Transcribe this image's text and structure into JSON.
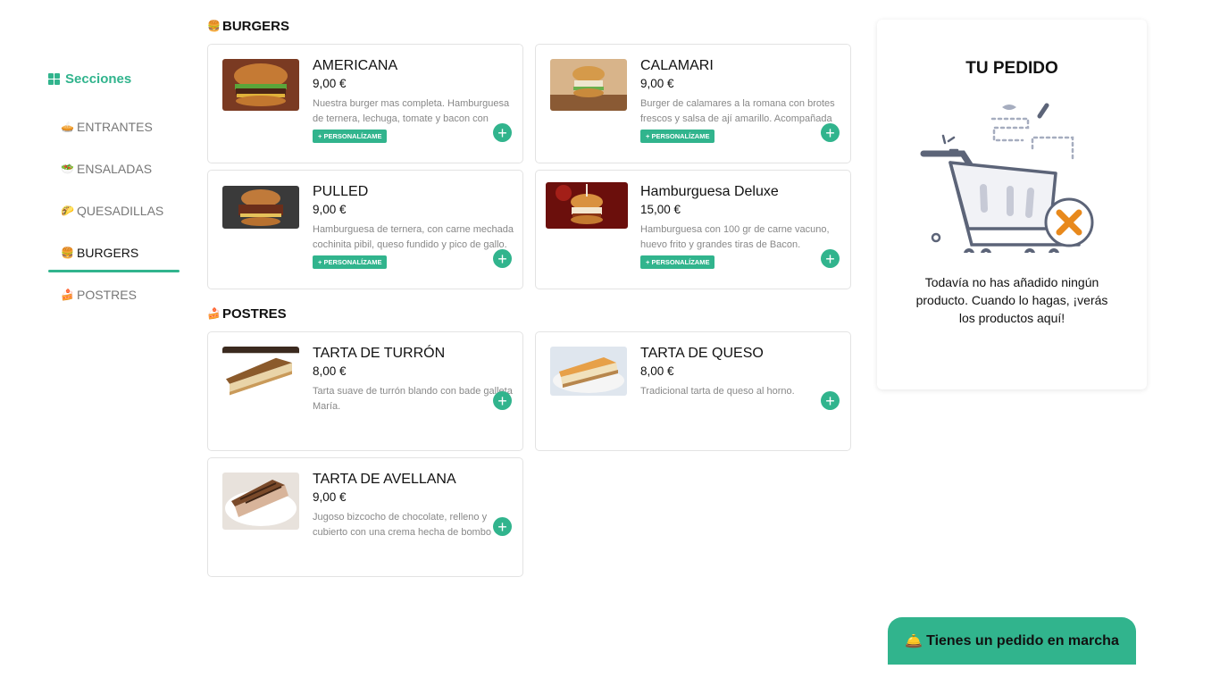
{
  "sidebar": {
    "title": "Secciones",
    "items": [
      {
        "emoji": "🥧",
        "label": "ENTRANTES",
        "active": false
      },
      {
        "emoji": "🥗",
        "label": "ENSALADAS",
        "active": false
      },
      {
        "emoji": "🌮",
        "label": "QUESADILLAS",
        "active": false
      },
      {
        "emoji": "🍔",
        "label": "BURGERS",
        "active": true
      },
      {
        "emoji": "🍰",
        "label": "POSTRES",
        "active": false
      }
    ]
  },
  "sections": {
    "burgers": {
      "emoji": "🍔",
      "title": "BURGERS",
      "products": [
        {
          "name": "AMERICANA",
          "price": "9,00 €",
          "description": "Nuestra burger mas completa. Hamburguesa de ternera, lechuga, tomate y bacon con",
          "badge": "+ PERSONALÍZAME",
          "add": "+"
        },
        {
          "name": "CALAMARI",
          "price": "9,00 €",
          "description": "Burger de calamares a la romana con brotes frescos y salsa de ají amarillo. Acompañada",
          "badge": "+ PERSONALÍZAME",
          "add": "+"
        },
        {
          "name": "PULLED",
          "price": "9,00 €",
          "description": "Hamburguesa de ternera, con carne mechada cochinita pibil, queso fundido y pico de gallo.",
          "badge": "+ PERSONALÍZAME",
          "add": "+"
        },
        {
          "name": "Hamburguesa Deluxe",
          "price": "15,00 €",
          "description": "Hamburguesa con 100 gr de carne vacuno, huevo frito y grandes tiras de Bacon.",
          "badge": "+ PERSONALÍZAME",
          "add": "+"
        }
      ]
    },
    "postres": {
      "emoji": "🍰",
      "title": "POSTRES",
      "products": [
        {
          "name": "TARTA DE TURRÓN",
          "price": "8,00 €",
          "description": "Tarta suave de turrón blando con bade galleta María.",
          "add": "+"
        },
        {
          "name": "TARTA DE QUESO",
          "price": "8,00 €",
          "description": "Tradicional tarta de queso al horno.",
          "add": "+"
        },
        {
          "name": "TARTA DE AVELLANA",
          "price": "9,00 €",
          "description": "Jugoso bizcocho de chocolate, relleno y cubierto con una crema hecha de bombo",
          "add": "+"
        }
      ]
    }
  },
  "order": {
    "title": "TU PEDIDO",
    "empty_message": "Todavía no has añadido ningún producto. Cuando lo hagas, ¡verás los productos aquí!"
  },
  "banner": {
    "emoji": "🛎️",
    "label": "Tienes un pedido en marcha"
  },
  "colors": {
    "accent": "#31b48d",
    "cart_remove": "#e8891c"
  },
  "icons": [
    "grid-icon",
    "plus-icon",
    "cart-icon",
    "bell-icon"
  ]
}
